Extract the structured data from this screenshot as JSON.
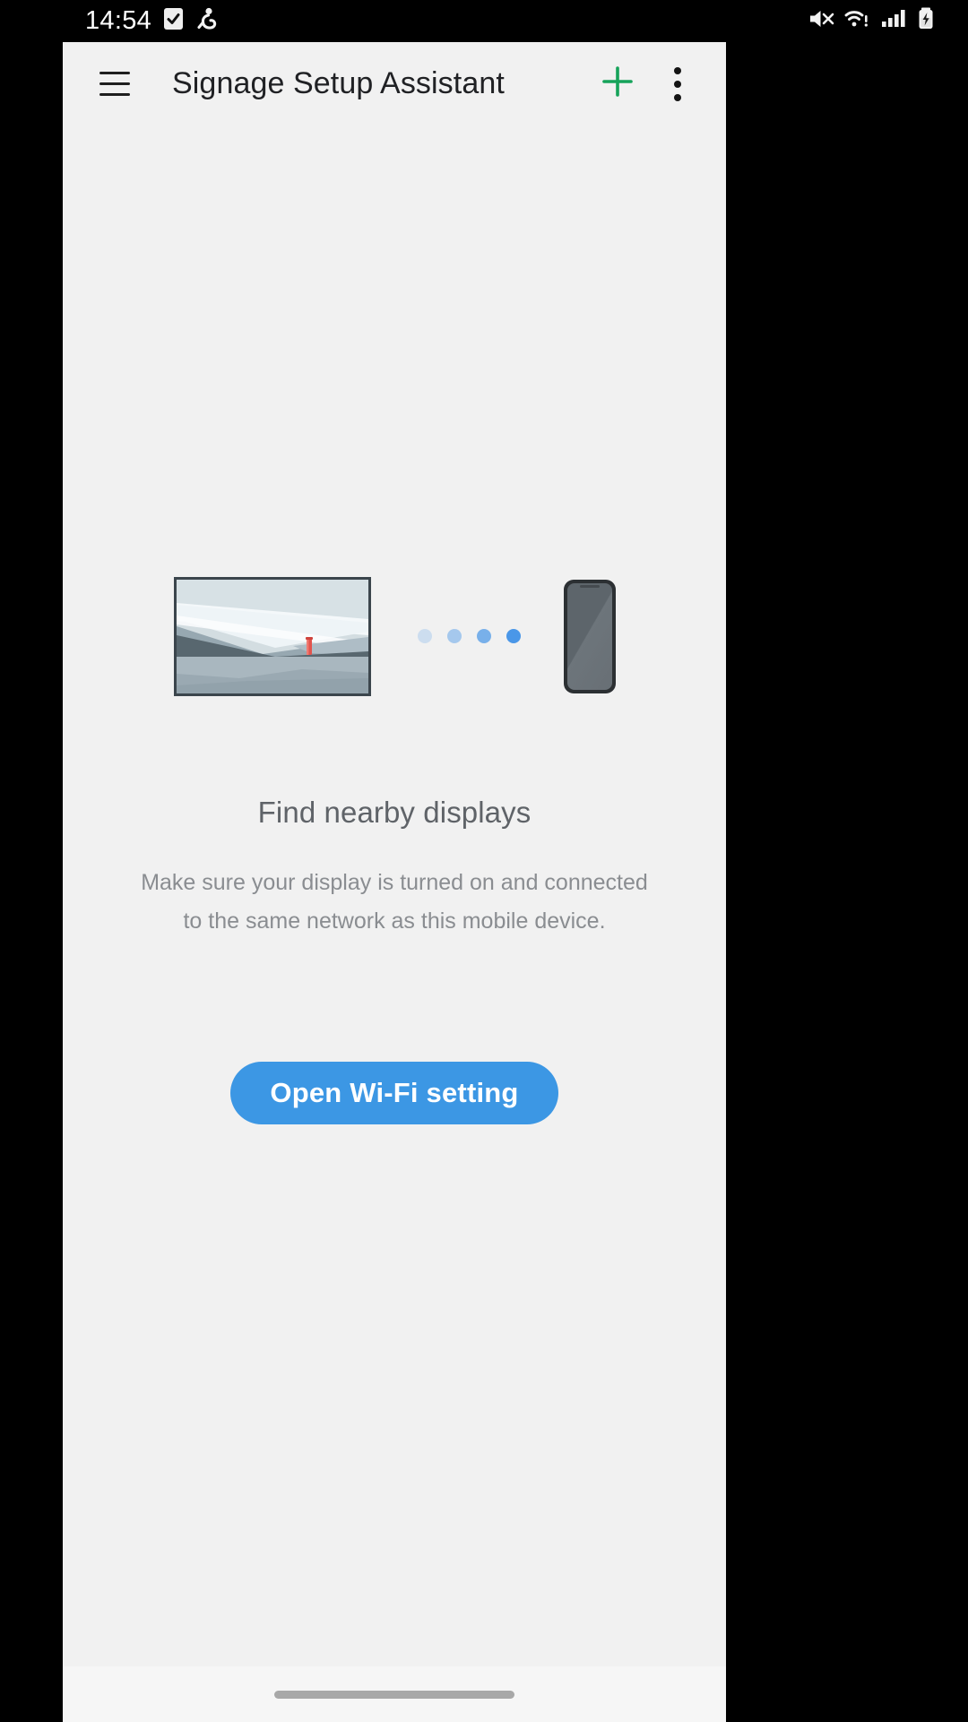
{
  "status_bar": {
    "time": "14:54",
    "left_icons": [
      "checkbox-checked-icon",
      "person-activity-icon"
    ],
    "right_icons": [
      "mute-icon",
      "wifi-warning-icon",
      "signal-bars-icon",
      "battery-charging-icon"
    ]
  },
  "app_bar": {
    "menu_icon": "hamburger-menu-icon",
    "title": "Signage Setup Assistant",
    "add_icon": "plus-icon",
    "overflow_icon": "more-vertical-icon",
    "add_color": "#16a35a"
  },
  "illustration": {
    "display_icon": "tv-display-icon",
    "phone_icon": "mobile-phone-icon",
    "dot_count": 4,
    "dot_color": "#4a97e8"
  },
  "main": {
    "headline": "Find nearby displays",
    "description": "Make sure your display is turned on and connected to the same network as this mobile device.",
    "primary_button": "Open Wi-Fi setting",
    "primary_button_color": "#3c97e4"
  },
  "nav_bar": {
    "home_indicator": "home-gesture-bar"
  }
}
